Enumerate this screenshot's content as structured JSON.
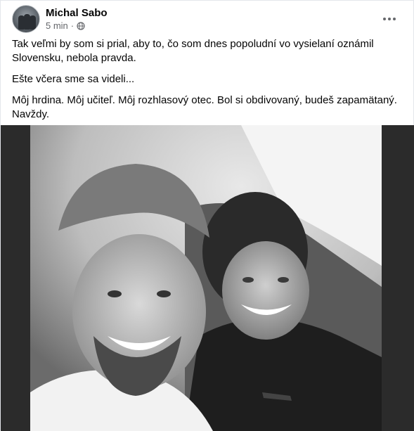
{
  "post": {
    "author": "Michal Sabo",
    "time": "5 min",
    "separator": "·",
    "privacy_icon": "globe-icon",
    "more_icon": "more-options-icon",
    "paragraphs": [
      "Tak veľmi by som si prial, aby to, čo som dnes popoludní vo vysielaní oznámil Slovensku, nebola pravda.",
      "Ešte včera sme sa videli...",
      "Môj hrdina. Môj učiteľ. Môj rozhlasový otec. Bol si obdivovaný, budeš zapamätaný. Navždy."
    ]
  },
  "colors": {
    "text": "#050505",
    "secondary": "#65676b",
    "photo_background": "#2b2b2b"
  }
}
